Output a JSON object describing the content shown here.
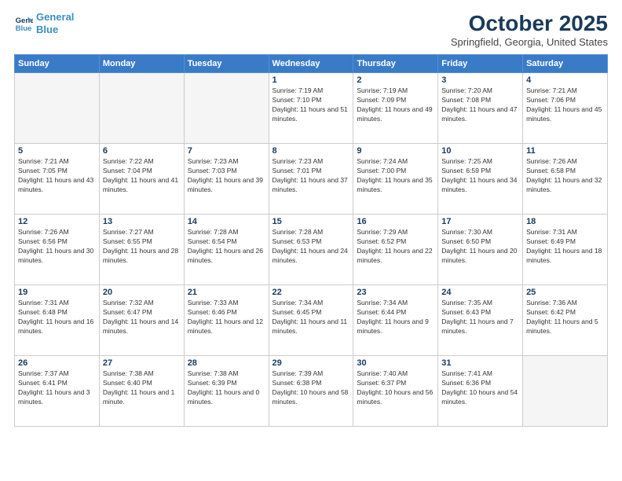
{
  "header": {
    "logo_line1": "General",
    "logo_line2": "Blue",
    "month_title": "October 2025",
    "location": "Springfield, Georgia, United States"
  },
  "weekdays": [
    "Sunday",
    "Monday",
    "Tuesday",
    "Wednesday",
    "Thursday",
    "Friday",
    "Saturday"
  ],
  "weeks": [
    [
      {
        "day": "",
        "empty": true
      },
      {
        "day": "",
        "empty": true
      },
      {
        "day": "",
        "empty": true
      },
      {
        "day": "1",
        "sunrise": "Sunrise: 7:19 AM",
        "sunset": "Sunset: 7:10 PM",
        "daylight": "Daylight: 11 hours and 51 minutes."
      },
      {
        "day": "2",
        "sunrise": "Sunrise: 7:19 AM",
        "sunset": "Sunset: 7:09 PM",
        "daylight": "Daylight: 11 hours and 49 minutes."
      },
      {
        "day": "3",
        "sunrise": "Sunrise: 7:20 AM",
        "sunset": "Sunset: 7:08 PM",
        "daylight": "Daylight: 11 hours and 47 minutes."
      },
      {
        "day": "4",
        "sunrise": "Sunrise: 7:21 AM",
        "sunset": "Sunset: 7:06 PM",
        "daylight": "Daylight: 11 hours and 45 minutes."
      }
    ],
    [
      {
        "day": "5",
        "sunrise": "Sunrise: 7:21 AM",
        "sunset": "Sunset: 7:05 PM",
        "daylight": "Daylight: 11 hours and 43 minutes."
      },
      {
        "day": "6",
        "sunrise": "Sunrise: 7:22 AM",
        "sunset": "Sunset: 7:04 PM",
        "daylight": "Daylight: 11 hours and 41 minutes."
      },
      {
        "day": "7",
        "sunrise": "Sunrise: 7:23 AM",
        "sunset": "Sunset: 7:03 PM",
        "daylight": "Daylight: 11 hours and 39 minutes."
      },
      {
        "day": "8",
        "sunrise": "Sunrise: 7:23 AM",
        "sunset": "Sunset: 7:01 PM",
        "daylight": "Daylight: 11 hours and 37 minutes."
      },
      {
        "day": "9",
        "sunrise": "Sunrise: 7:24 AM",
        "sunset": "Sunset: 7:00 PM",
        "daylight": "Daylight: 11 hours and 35 minutes."
      },
      {
        "day": "10",
        "sunrise": "Sunrise: 7:25 AM",
        "sunset": "Sunset: 6:59 PM",
        "daylight": "Daylight: 11 hours and 34 minutes."
      },
      {
        "day": "11",
        "sunrise": "Sunrise: 7:26 AM",
        "sunset": "Sunset: 6:58 PM",
        "daylight": "Daylight: 11 hours and 32 minutes."
      }
    ],
    [
      {
        "day": "12",
        "sunrise": "Sunrise: 7:26 AM",
        "sunset": "Sunset: 6:56 PM",
        "daylight": "Daylight: 11 hours and 30 minutes."
      },
      {
        "day": "13",
        "sunrise": "Sunrise: 7:27 AM",
        "sunset": "Sunset: 6:55 PM",
        "daylight": "Daylight: 11 hours and 28 minutes."
      },
      {
        "day": "14",
        "sunrise": "Sunrise: 7:28 AM",
        "sunset": "Sunset: 6:54 PM",
        "daylight": "Daylight: 11 hours and 26 minutes."
      },
      {
        "day": "15",
        "sunrise": "Sunrise: 7:28 AM",
        "sunset": "Sunset: 6:53 PM",
        "daylight": "Daylight: 11 hours and 24 minutes."
      },
      {
        "day": "16",
        "sunrise": "Sunrise: 7:29 AM",
        "sunset": "Sunset: 6:52 PM",
        "daylight": "Daylight: 11 hours and 22 minutes."
      },
      {
        "day": "17",
        "sunrise": "Sunrise: 7:30 AM",
        "sunset": "Sunset: 6:50 PM",
        "daylight": "Daylight: 11 hours and 20 minutes."
      },
      {
        "day": "18",
        "sunrise": "Sunrise: 7:31 AM",
        "sunset": "Sunset: 6:49 PM",
        "daylight": "Daylight: 11 hours and 18 minutes."
      }
    ],
    [
      {
        "day": "19",
        "sunrise": "Sunrise: 7:31 AM",
        "sunset": "Sunset: 6:48 PM",
        "daylight": "Daylight: 11 hours and 16 minutes."
      },
      {
        "day": "20",
        "sunrise": "Sunrise: 7:32 AM",
        "sunset": "Sunset: 6:47 PM",
        "daylight": "Daylight: 11 hours and 14 minutes."
      },
      {
        "day": "21",
        "sunrise": "Sunrise: 7:33 AM",
        "sunset": "Sunset: 6:46 PM",
        "daylight": "Daylight: 11 hours and 12 minutes."
      },
      {
        "day": "22",
        "sunrise": "Sunrise: 7:34 AM",
        "sunset": "Sunset: 6:45 PM",
        "daylight": "Daylight: 11 hours and 11 minutes."
      },
      {
        "day": "23",
        "sunrise": "Sunrise: 7:34 AM",
        "sunset": "Sunset: 6:44 PM",
        "daylight": "Daylight: 11 hours and 9 minutes."
      },
      {
        "day": "24",
        "sunrise": "Sunrise: 7:35 AM",
        "sunset": "Sunset: 6:43 PM",
        "daylight": "Daylight: 11 hours and 7 minutes."
      },
      {
        "day": "25",
        "sunrise": "Sunrise: 7:36 AM",
        "sunset": "Sunset: 6:42 PM",
        "daylight": "Daylight: 11 hours and 5 minutes."
      }
    ],
    [
      {
        "day": "26",
        "sunrise": "Sunrise: 7:37 AM",
        "sunset": "Sunset: 6:41 PM",
        "daylight": "Daylight: 11 hours and 3 minutes."
      },
      {
        "day": "27",
        "sunrise": "Sunrise: 7:38 AM",
        "sunset": "Sunset: 6:40 PM",
        "daylight": "Daylight: 11 hours and 1 minute."
      },
      {
        "day": "28",
        "sunrise": "Sunrise: 7:38 AM",
        "sunset": "Sunset: 6:39 PM",
        "daylight": "Daylight: 11 hours and 0 minutes."
      },
      {
        "day": "29",
        "sunrise": "Sunrise: 7:39 AM",
        "sunset": "Sunset: 6:38 PM",
        "daylight": "Daylight: 10 hours and 58 minutes."
      },
      {
        "day": "30",
        "sunrise": "Sunrise: 7:40 AM",
        "sunset": "Sunset: 6:37 PM",
        "daylight": "Daylight: 10 hours and 56 minutes."
      },
      {
        "day": "31",
        "sunrise": "Sunrise: 7:41 AM",
        "sunset": "Sunset: 6:36 PM",
        "daylight": "Daylight: 10 hours and 54 minutes."
      },
      {
        "day": "",
        "empty": true
      }
    ]
  ]
}
